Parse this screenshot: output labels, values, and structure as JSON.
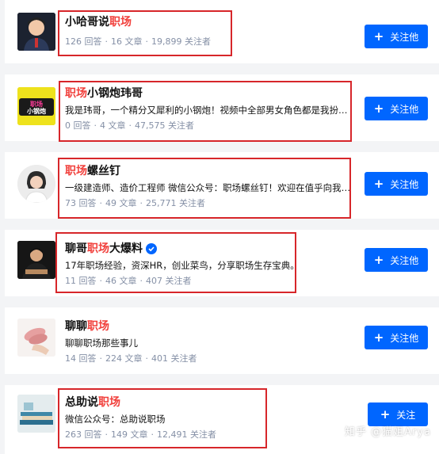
{
  "follow_label": "关注他",
  "follow_label_last": "关注",
  "users": [
    {
      "name_parts": [
        {
          "text": "小哈哥说",
          "hl": false
        },
        {
          "text": "职场",
          "hl": true
        }
      ],
      "desc": "",
      "answers": "126 回答",
      "articles": "16 文章",
      "followers": "19,899 关注者"
    },
    {
      "name_parts": [
        {
          "text": "职场",
          "hl": true
        },
        {
          "text": "小钢炮玮哥",
          "hl": false
        }
      ],
      "desc": "我是玮哥，一个精分又犀利的小钢炮！视频中全部男女角色都是我扮演的",
      "answers": "0 回答",
      "articles": "4 文章",
      "followers": "47,575 关注者",
      "avatar_text": "职场小钢炮"
    },
    {
      "name_parts": [
        {
          "text": "职场",
          "hl": true
        },
        {
          "text": "螺丝钉",
          "hl": false
        }
      ],
      "desc": "一级建造师、造价工程师 微信公众号：职场螺丝钉！欢迎在值乎向我提…",
      "answers": "73 回答",
      "articles": "49 文章",
      "followers": "25,771 关注者"
    },
    {
      "name_parts": [
        {
          "text": "聊哥",
          "hl": false
        },
        {
          "text": "职场",
          "hl": true
        },
        {
          "text": "大爆料",
          "hl": false
        }
      ],
      "desc": "17年职场经验，资深HR，创业菜鸟，分享职场生存宝典。",
      "answers": "11 回答",
      "articles": "46 文章",
      "followers": "407 关注者"
    },
    {
      "name_parts": [
        {
          "text": "聊聊",
          "hl": false
        },
        {
          "text": "职场",
          "hl": true
        }
      ],
      "desc": "聊聊职场那些事儿",
      "answers": "14 回答",
      "articles": "224 文章",
      "followers": "401 关注者"
    },
    {
      "name_parts": [
        {
          "text": "总助说",
          "hl": false
        },
        {
          "text": "职场",
          "hl": true
        }
      ],
      "desc": "微信公众号：总助说职场",
      "answers": "263 回答",
      "articles": "149 文章",
      "followers": "12,491 关注者"
    }
  ],
  "watermark": "知乎 @猫姐Arya",
  "colors": {
    "accent": "#0066ff",
    "highlight": "#f1403c",
    "box": "#d7262a"
  }
}
